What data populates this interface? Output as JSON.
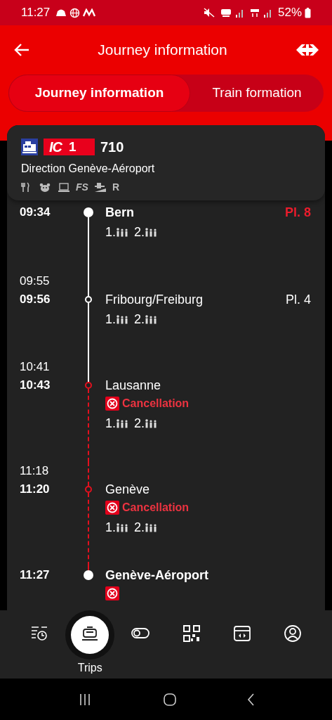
{
  "status_bar": {
    "time": "11:27",
    "battery": "52%"
  },
  "header": {
    "title": "Journey information"
  },
  "tabs": [
    {
      "label": "Journey information",
      "selected": true
    },
    {
      "label": "Train formation",
      "selected": false
    }
  ],
  "train": {
    "category": "IC",
    "line": "1",
    "number": "710",
    "direction": "Direction Genève-Aéroport",
    "amenities": [
      {
        "kind": "cutlery"
      },
      {
        "kind": "bear"
      },
      {
        "kind": "laptop"
      },
      {
        "kind": "label",
        "text": "FS"
      },
      {
        "kind": "ramp"
      },
      {
        "kind": "label",
        "text": "R"
      }
    ]
  },
  "stops": [
    {
      "time": "09:34",
      "name": "Bern",
      "terminal": true,
      "bold": true,
      "platform": "Pl. 8",
      "platform_changed": true,
      "cancelled": false,
      "classes": [
        "1.",
        "2."
      ]
    },
    {
      "planned": "09:55",
      "time": "09:56",
      "name": "Fribourg/Freiburg",
      "terminal": false,
      "bold": false,
      "platform": "Pl. 4",
      "platform_changed": false,
      "cancelled": false,
      "classes": [
        "1.",
        "2."
      ]
    },
    {
      "planned": "10:41",
      "time": "10:43",
      "name": "Lausanne",
      "terminal": false,
      "bold": false,
      "cancelled": true,
      "notice": "Cancellation",
      "classes": [
        "1.",
        "2."
      ]
    },
    {
      "planned": "11:18",
      "time": "11:20",
      "name": "Genève",
      "terminal": false,
      "bold": false,
      "cancelled": true,
      "notice": "Cancellation",
      "classes": [
        "1.",
        "2."
      ]
    },
    {
      "time": "11:27",
      "name": "Genève-Aéroport",
      "terminal": true,
      "bold": true,
      "cancelled": true
    }
  ],
  "bottom_nav": [
    {
      "selected": false
    },
    {
      "selected": true,
      "label": "Trips"
    },
    {
      "selected": false
    },
    {
      "selected": false
    },
    {
      "selected": false
    },
    {
      "selected": false
    }
  ]
}
